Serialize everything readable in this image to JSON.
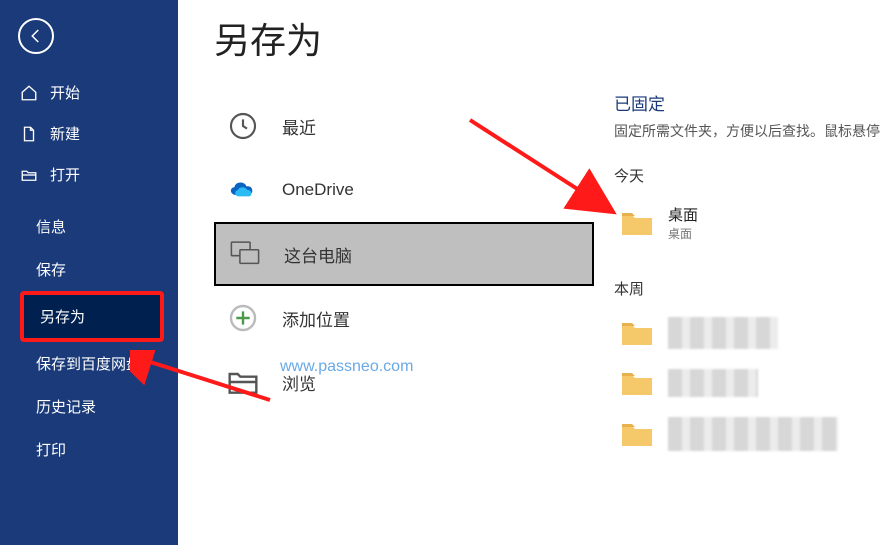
{
  "page_title": "另存为",
  "sidebar": {
    "items": [
      {
        "label": "开始",
        "icon": "home-icon"
      },
      {
        "label": "新建",
        "icon": "file-icon"
      },
      {
        "label": "打开",
        "icon": "folder-open-icon"
      },
      {
        "label": "信息"
      },
      {
        "label": "保存"
      },
      {
        "label": "另存为"
      },
      {
        "label": "保存到百度网盘"
      },
      {
        "label": "历史记录"
      },
      {
        "label": "打印"
      }
    ]
  },
  "locations": [
    {
      "label": "最近",
      "icon": "clock-icon"
    },
    {
      "label": "OneDrive",
      "icon": "onedrive-icon"
    },
    {
      "label": "这台电脑",
      "icon": "this-pc-icon"
    },
    {
      "label": "添加位置",
      "icon": "add-location-icon"
    },
    {
      "label": "浏览",
      "icon": "browse-icon"
    }
  ],
  "right": {
    "pinned_title": "已固定",
    "pinned_sub": "固定所需文件夹，方便以后查找。鼠标悬停",
    "today_title": "今天",
    "desktop_name": "桌面",
    "desktop_path": "桌面",
    "week_title": "本周"
  },
  "watermark": "www.passneo.com"
}
